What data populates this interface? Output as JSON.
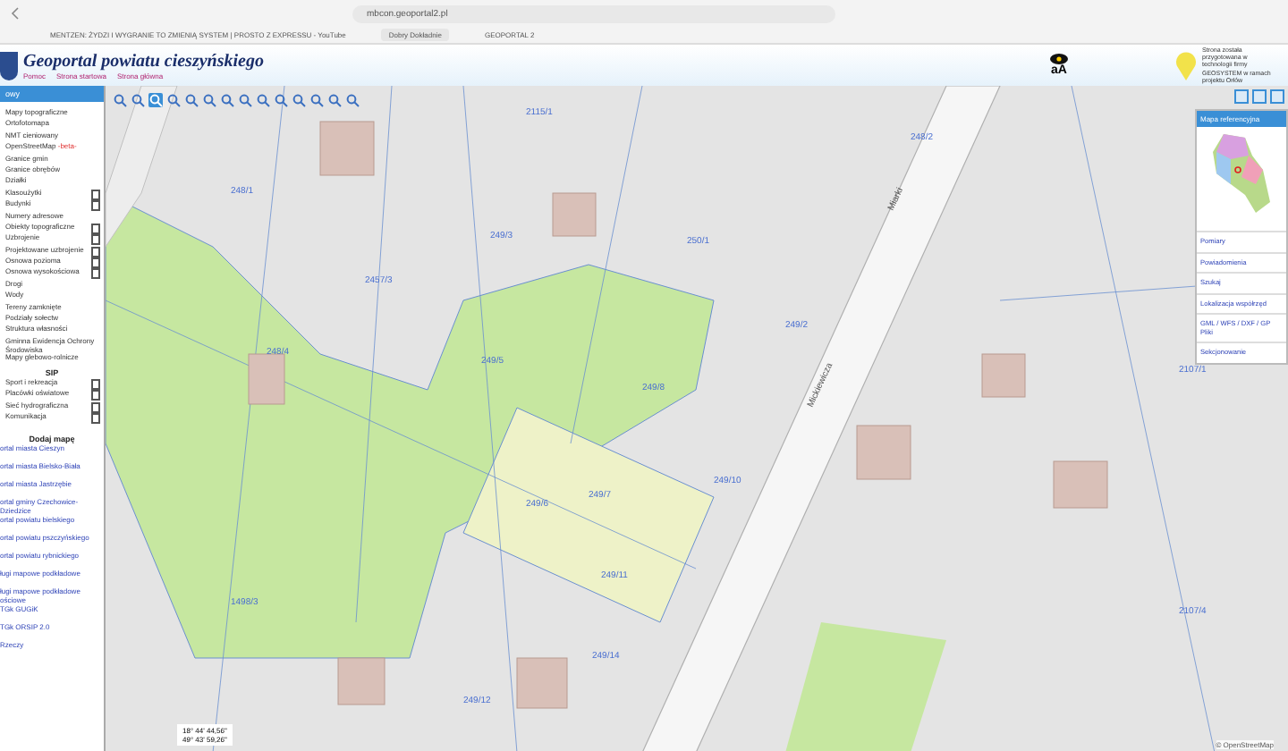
{
  "browser": {
    "url": "mbcon.geoportal2.pl",
    "tabs": [
      {
        "title": "MENTZEN: ŻYDZI I WYGRANIE TO ZMIENIĄ SYSTEM | PROSTO Z EXPRESSU - YouTube",
        "selected": false
      },
      {
        "title": "Dobry Dokładnie",
        "selected": true
      },
      {
        "title": "GEOPORTAL 2",
        "selected": false
      }
    ]
  },
  "header": {
    "title": "Geoportal powiatu cieszyńskiego",
    "links": [
      "Pomoc",
      "Strona startowa",
      "Strona główna"
    ],
    "text_size": "aA",
    "info": "Strona została przygotowana w technologii firmy GEOSYSTEM w ramach projektu Orłów"
  },
  "sidebar": {
    "title": "owy",
    "layers": [
      {
        "label": "Mapy topograficzne",
        "doc": false
      },
      {
        "label": "Ortofotomapa",
        "doc": false
      },
      {
        "label": "NMT cieniowany",
        "doc": false
      },
      {
        "label": "OpenStreetMap",
        "badge": "-beta-",
        "doc": false
      },
      {
        "label": "Granice gmin",
        "doc": false
      },
      {
        "label": "Granice obrębów",
        "doc": false
      },
      {
        "label": "Działki",
        "doc": false
      },
      {
        "label": "Klasoużytki",
        "doc": true
      },
      {
        "label": "Budynki",
        "doc": true
      },
      {
        "label": "Numery adresowe",
        "doc": false
      },
      {
        "label": "Obiekty topograficzne",
        "doc": true
      },
      {
        "label": "Uzbrojenie",
        "doc": true
      },
      {
        "label": "Projektowane uzbrojenie",
        "doc": true
      },
      {
        "label": "Osnowa pozioma",
        "doc": true
      },
      {
        "label": "Osnowa wysokościowa",
        "doc": true
      },
      {
        "label": "Drogi",
        "doc": false
      },
      {
        "label": "Wody",
        "doc": false
      },
      {
        "label": "Tereny zamknięte",
        "doc": false
      },
      {
        "label": "Podziały sołectw",
        "doc": false
      },
      {
        "label": "Struktura własności",
        "doc": false
      },
      {
        "label": "Gminna Ewidencja Ochrony Środowiska",
        "doc": false
      },
      {
        "label": "Mapy glebowo-rolnicze",
        "doc": false
      }
    ],
    "sip_title": "SIP",
    "sip_layers": [
      {
        "label": "Sport i rekreacja",
        "doc": true
      },
      {
        "label": "Placówki oświatowe",
        "doc": true
      },
      {
        "label": "Sieć hydrograficzna",
        "doc": true
      },
      {
        "label": "Komunikacja",
        "doc": true
      }
    ],
    "add_title": "Dodaj mapę",
    "add_links": [
      "ortal miasta Cieszyn",
      "ortal miasta Bielsko-Biała",
      "ortal miasta Jastrzębie",
      "ortal gminy Czechowice-Dziedzice",
      "ortal powiatu bielskiego",
      "ortal powiatu pszczyńskiego",
      "ortal powiatu rybnickiego",
      "ługi mapowe podkładowe",
      "ługi mapowe podkładowe ościowe",
      "TGk GUGiK",
      "TGk ORSIP 2.0",
      "Rzeczy"
    ]
  },
  "map": {
    "parcels": [
      "2115/1",
      "248/1",
      "249/3",
      "2457/3",
      "248/4",
      "249/5",
      "249/6",
      "249/7",
      "249/8",
      "250/1",
      "249/10",
      "249/11",
      "249/14",
      "249/12",
      "2107/1",
      "2107/4",
      "1498/3",
      "249/2",
      "248/2"
    ],
    "streets": [
      "Miarki",
      "Mickiewicza"
    ],
    "coords": [
      "18° 44' 44,56\"",
      "49° 43' 59,26\""
    ],
    "attribution": "© OpenStreetMap"
  },
  "right_panel": {
    "title": "Mapa referencyjna",
    "items": [
      "Pomiary",
      "Powiadomienia",
      "Szukaj",
      "Lokalizacja współrzęd",
      "GML / WFS / DXF / GP Pliki",
      "Sekcjonowanie"
    ]
  }
}
